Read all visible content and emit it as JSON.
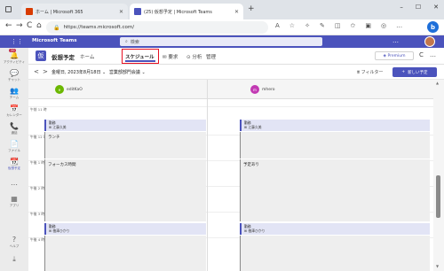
{
  "browser": {
    "tabs": [
      {
        "title": "ホーム | Microsoft 365",
        "favicon_color": "#d83b01"
      },
      {
        "title": "(25) 仮想予定 | Microsoft Teams",
        "favicon_color": "#4b53bc"
      }
    ],
    "new_tab": "+",
    "window_controls": {
      "minimize": "–",
      "maximize": "☐",
      "close": "✕"
    },
    "url": "https://teams.microsoft.com/",
    "nav": {
      "back": "←",
      "forward": "→",
      "refresh": "C",
      "home": "⌂"
    }
  },
  "teams": {
    "app_name": "Microsoft Teams",
    "search_placeholder": "検索",
    "more": "…"
  },
  "rail": {
    "items": [
      {
        "label": "アクティビティ",
        "icon": "bell-icon",
        "glyph": "🔔",
        "badge": "20"
      },
      {
        "label": "チャット",
        "icon": "chat-icon",
        "glyph": "💬"
      },
      {
        "label": "チーム",
        "icon": "teams-icon",
        "glyph": "👥"
      },
      {
        "label": "カレンダー",
        "icon": "calendar-icon",
        "glyph": "📅"
      },
      {
        "label": "通話",
        "icon": "phone-icon",
        "glyph": "📞"
      },
      {
        "label": "ファイル",
        "icon": "file-icon",
        "glyph": "📄"
      },
      {
        "label": "仮想予定",
        "icon": "schedule-icon",
        "glyph": "📆",
        "active": true
      },
      {
        "label": "",
        "icon": "more-icon",
        "glyph": "…"
      },
      {
        "label": "アプリ",
        "icon": "apps-icon",
        "glyph": "▦"
      },
      {
        "label": "ヘルプ",
        "icon": "help-icon",
        "glyph": "?"
      },
      {
        "label": "",
        "icon": "download-icon",
        "glyph": "⤓"
      }
    ]
  },
  "channel": {
    "icon_letter": "仮",
    "name": "仮想予定",
    "tabs": [
      "ホーム",
      "スケジュール",
      "要求",
      "分析",
      "管理"
    ],
    "selected_tab": "スケジュール",
    "premium": "Premium",
    "refresh": "C",
    "more": "…"
  },
  "toolbar": {
    "prev": "<",
    "next": ">",
    "date": "金曜日, 2023年8月18日",
    "group": "営業部部門会議",
    "filter": "フィルター",
    "new_shift": "新しい予定"
  },
  "people": [
    {
      "name": "editKaO",
      "initials": "e",
      "color": "#6bb700"
    },
    {
      "name": "mhero",
      "initials": "m",
      "color": "#c239b3"
    }
  ],
  "times": [
    "午前 11 時",
    "午後 12 時",
    "午後 1 時",
    "午後 2 時",
    "午後 3 時",
    "午後 4 時"
  ],
  "shifts": {
    "left_top": {
      "title": "勤務",
      "person": "江藤久美"
    },
    "right_top": {
      "title": "勤務",
      "person": "江藤久美"
    },
    "left_bottom": {
      "title": "勤務",
      "person": "植澤ひかり"
    },
    "right_bottom": {
      "title": "勤務",
      "person": "植澤ひかり"
    }
  },
  "blocks": {
    "lunch": "ランチ",
    "focus": "フォーカス時間",
    "meeting": "予定あり"
  },
  "colors": {
    "teams_purple": "#4b53bc",
    "highlight_red": "#e81123"
  }
}
